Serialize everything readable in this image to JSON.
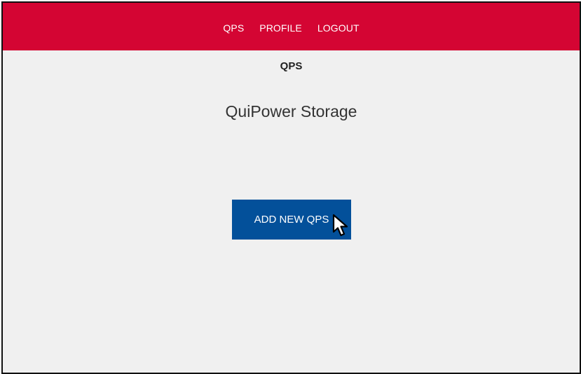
{
  "navbar": {
    "links": [
      "QPS",
      "PROFILE",
      "LOGOUT"
    ],
    "color": "#d40533"
  },
  "page": {
    "heading": "QPS",
    "title": "QuiPower Storage"
  },
  "actions": {
    "add_button_label": "ADD NEW QPS",
    "button_color": "#03509a"
  },
  "icons": {
    "cursor": "mouse-pointer-icon"
  }
}
